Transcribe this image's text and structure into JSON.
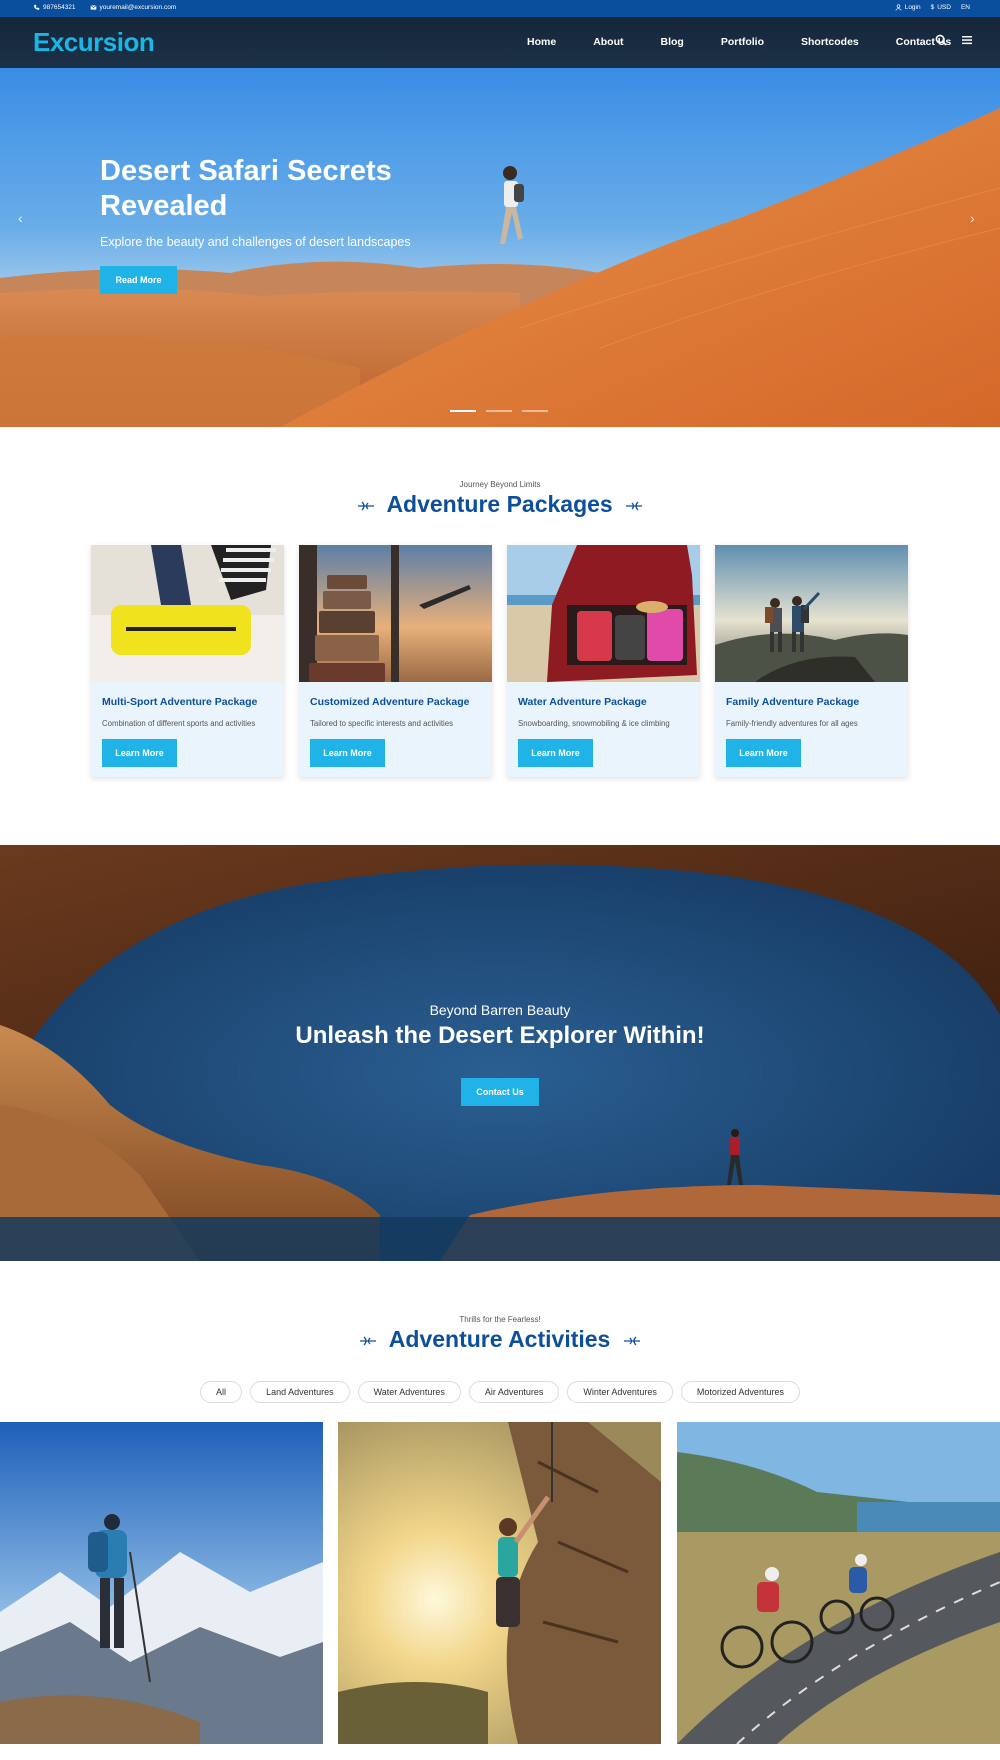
{
  "topbar": {
    "phone": "987654321",
    "email": "youremail@excursion.com",
    "login": "Login",
    "currency": "USD",
    "lang": "EN"
  },
  "nav": {
    "logo": "Excursion",
    "items": [
      "Home",
      "About",
      "Blog",
      "Portfolio",
      "Shortcodes",
      "Contact Us"
    ]
  },
  "hero": {
    "title": "Desert Safari Secrets Revealed",
    "subtitle": "Explore the beauty and challenges of desert landscapes",
    "button": "Read More",
    "slide_count": 3,
    "active_slide": 1
  },
  "packages": {
    "kicker": "Journey Beyond Limits",
    "title": "Adventure Packages",
    "items": [
      {
        "title": "Multi-Sport Adventure Package",
        "desc": "Combination of different sports and activities",
        "button": "Learn More"
      },
      {
        "title": "Customized Adventure Package",
        "desc": "Tailored to specific interests and activities",
        "button": "Learn More"
      },
      {
        "title": "Water Adventure Package",
        "desc": "Snowboarding, snowmobiling & ice climbing",
        "button": "Learn More"
      },
      {
        "title": "Family Adventure Package",
        "desc": "Family-friendly adventures for all ages",
        "button": "Learn More"
      }
    ]
  },
  "banner": {
    "kicker": "Beyond Barren Beauty",
    "title": "Unleash the Desert Explorer Within!",
    "button": "Contact Us"
  },
  "activities": {
    "kicker": "Thrills for the Fearless!",
    "title": "Adventure Activities",
    "filters": [
      "All",
      "Land Adventures",
      "Water Adventures",
      "Air Adventures",
      "Winter Adventures",
      "Motorized Adventures"
    ]
  },
  "colors": {
    "accent": "#1fb3e8",
    "brand_blue": "#0d4f9a",
    "topbar": "#0a4e9e",
    "nav_bg": "#18293d"
  }
}
